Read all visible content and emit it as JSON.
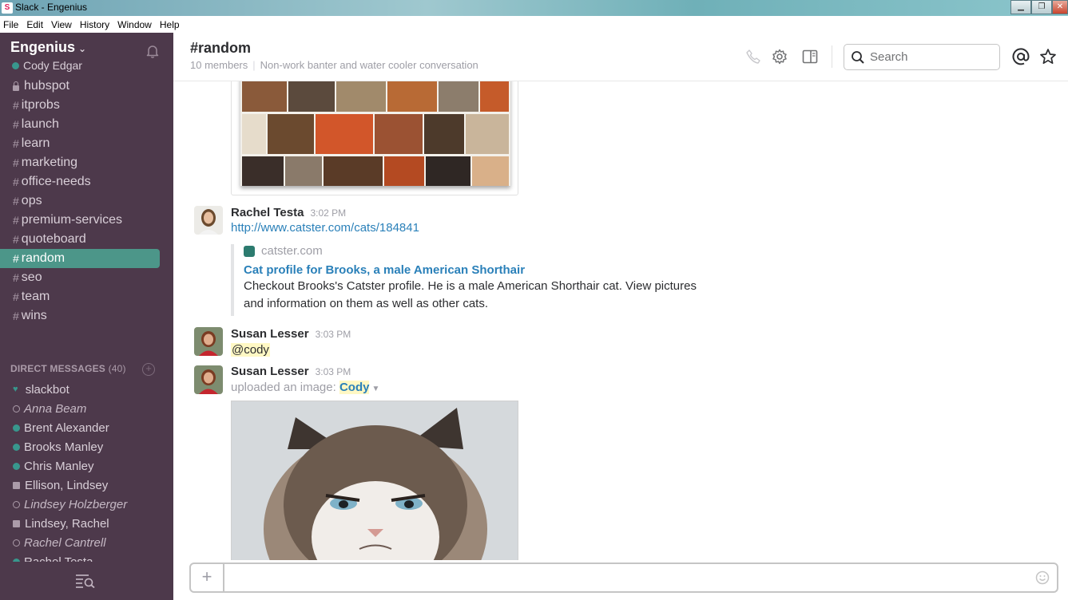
{
  "window": {
    "title": "Slack - Engenius",
    "app_icon_letter": "S",
    "controls": [
      "minimize",
      "maximize",
      "close"
    ]
  },
  "menubar": [
    "File",
    "Edit",
    "View",
    "History",
    "Window",
    "Help"
  ],
  "sidebar": {
    "team_name": "Engenius",
    "user_name": "Cody Edgar",
    "channels": [
      {
        "name": "hubspot",
        "private": true
      },
      {
        "name": "itprobs"
      },
      {
        "name": "launch"
      },
      {
        "name": "learn"
      },
      {
        "name": "marketing"
      },
      {
        "name": "office-needs"
      },
      {
        "name": "ops"
      },
      {
        "name": "premium-services"
      },
      {
        "name": "quoteboard"
      },
      {
        "name": "random",
        "active": true
      },
      {
        "name": "seo"
      },
      {
        "name": "team"
      },
      {
        "name": "wins"
      }
    ],
    "dm_header": "DIRECT MESSAGES",
    "dm_count": "(40)",
    "direct_messages": [
      {
        "name": "slackbot",
        "status": "bot"
      },
      {
        "name": "Anna Beam",
        "status": "away"
      },
      {
        "name": "Brent Alexander",
        "status": "online"
      },
      {
        "name": "Brooks Manley",
        "status": "online"
      },
      {
        "name": "Chris Manley",
        "status": "online"
      },
      {
        "name": "Ellison, Lindsey",
        "status": "group"
      },
      {
        "name": "Lindsey Holzberger",
        "status": "away"
      },
      {
        "name": "Lindsey, Rachel",
        "status": "group"
      },
      {
        "name": "Rachel Cantrell",
        "status": "away"
      },
      {
        "name": "Rachel Testa",
        "status": "online"
      }
    ]
  },
  "header": {
    "channel_title": "#random",
    "members": "10 members",
    "purpose": "Non-work banter and water cooler conversation",
    "search_placeholder": "Search"
  },
  "messages": [
    {
      "author": "Rachel Testa",
      "time": "3:02 PM",
      "link": "http://www.catster.com/cats/184841",
      "attachment": {
        "site": "catster.com",
        "title": "Cat profile for Brooks, a male American Shorthair",
        "description": "Checkout Brooks's Catster profile. He is a male American Shorthair cat. View pictures and information on them as well as other cats."
      }
    },
    {
      "author": "Susan Lesser",
      "time": "3:03 PM",
      "text": "@cody"
    },
    {
      "author": "Susan Lesser",
      "time": "3:03 PM",
      "upload_prefix": "uploaded an image:",
      "file_name": "Cody"
    }
  ],
  "colors": {
    "sidebar_bg": "#4d394b",
    "active_channel": "#4c9689",
    "presence_online": "#38978d",
    "link": "#2a80b9"
  }
}
